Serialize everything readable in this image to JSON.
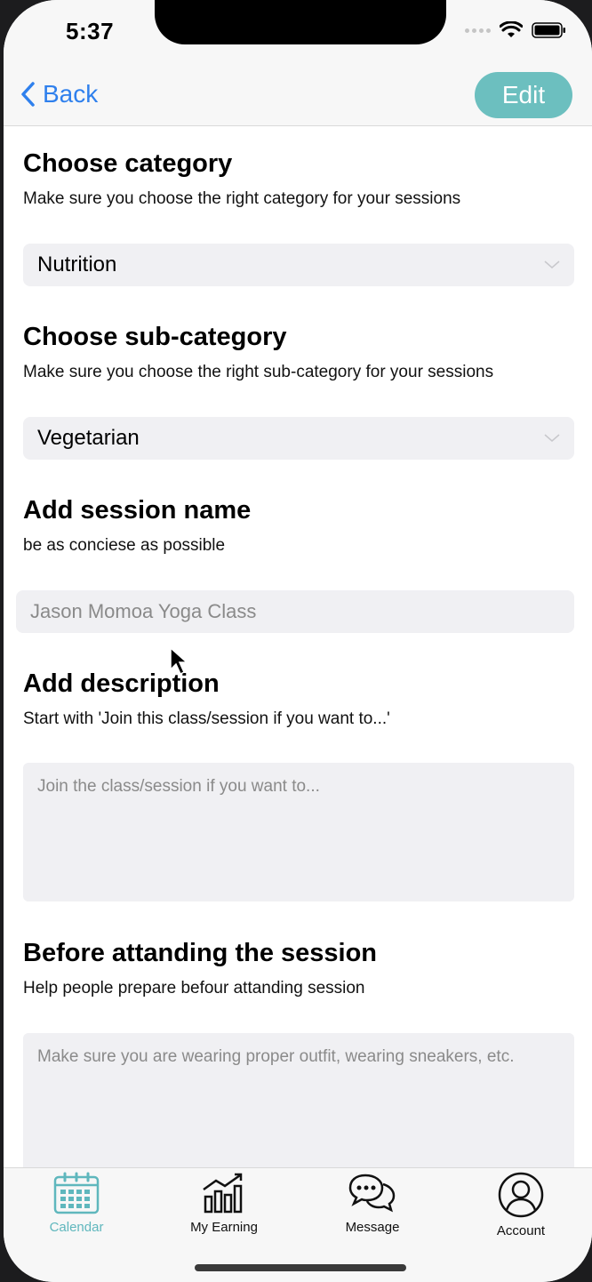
{
  "status": {
    "time": "5:37"
  },
  "nav": {
    "back_label": "Back",
    "edit_label": "Edit"
  },
  "category": {
    "title": "Choose category",
    "subtitle": "Make sure you choose the right category for your sessions",
    "selected": "Nutrition"
  },
  "subcategory": {
    "title": "Choose sub-category",
    "subtitle": "Make sure you choose the right sub-category for your sessions",
    "selected": "Vegetarian"
  },
  "session_name": {
    "title": "Add session name",
    "subtitle": "be as conciese as possible",
    "placeholder": "Jason Momoa Yoga Class"
  },
  "description": {
    "title": "Add description",
    "subtitle": "Start with 'Join this class/session if you want to...'",
    "placeholder": "Join the class/session if you want to..."
  },
  "before": {
    "title": "Before attanding the session",
    "subtitle": "Help people prepare befour attanding session",
    "placeholder": "Make sure you are wearing proper outfit, wearing sneakers, etc."
  },
  "tabs": [
    {
      "label": "Calendar",
      "icon": "calendar-icon",
      "active": true
    },
    {
      "label": "My Earning",
      "icon": "chart-icon",
      "active": false
    },
    {
      "label": "Message",
      "icon": "chat-icon",
      "active": false
    },
    {
      "label": "Account",
      "icon": "user-icon",
      "active": false
    }
  ],
  "colors": {
    "accent": "#6cbfbf",
    "link": "#2f80ed",
    "field_bg": "#f0f0f3",
    "tab_active": "#5fb7bd"
  }
}
